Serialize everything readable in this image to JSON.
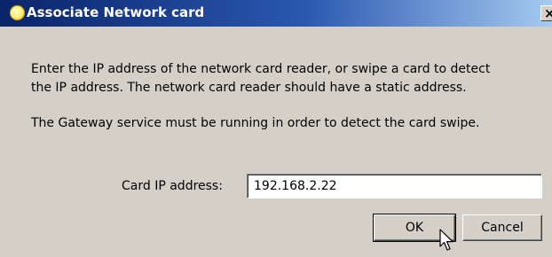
{
  "window": {
    "title": "Associate Network card",
    "close_glyph": "×",
    "title_icon": "app-icon"
  },
  "message": {
    "line1": "Enter the IP address of the network card reader, or swipe a card to detect",
    "line2": "the IP address.  The network card reader should have a static address.",
    "line3": "The Gateway service must be running in order to detect the card swipe."
  },
  "form": {
    "card_ip_label": "Card IP address:",
    "card_ip_value": "192.168.2.22"
  },
  "buttons": {
    "ok_label": "OK",
    "cancel_label": "Cancel"
  },
  "colors": {
    "titlebar_dark": "#0a246a",
    "titlebar_light": "#a6caf0",
    "dialog_face": "#d4d0c8"
  }
}
